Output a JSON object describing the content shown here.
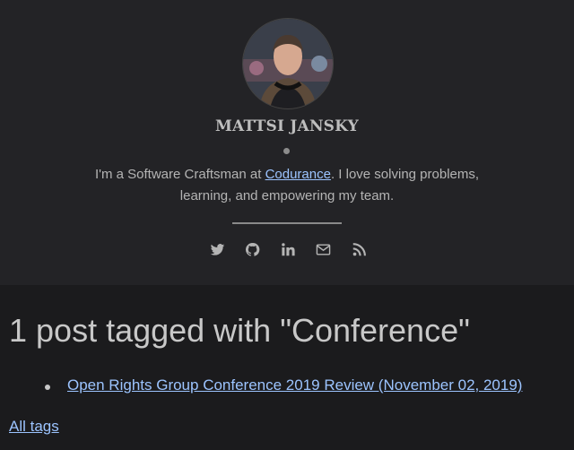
{
  "profile": {
    "name": "MATTSI JANSKY",
    "bio_before": "I'm a Software Craftsman at ",
    "bio_link": "Codurance",
    "bio_after": ". I love solving problems, learning, and empowering my team."
  },
  "social": {
    "icons": [
      "twitter-icon",
      "github-icon",
      "linkedin-icon",
      "envelope-icon",
      "rss-icon"
    ]
  },
  "main": {
    "heading": "1 post tagged with \"Conference\"",
    "posts": [
      "Open Rights Group Conference 2019 Review (November 02, 2019)"
    ],
    "all_tags_label": "All tags"
  },
  "colors": {
    "background": "#1b1b1d",
    "header_background": "#232326",
    "link": "#9cc4ff",
    "text": "#c8c8c8"
  }
}
